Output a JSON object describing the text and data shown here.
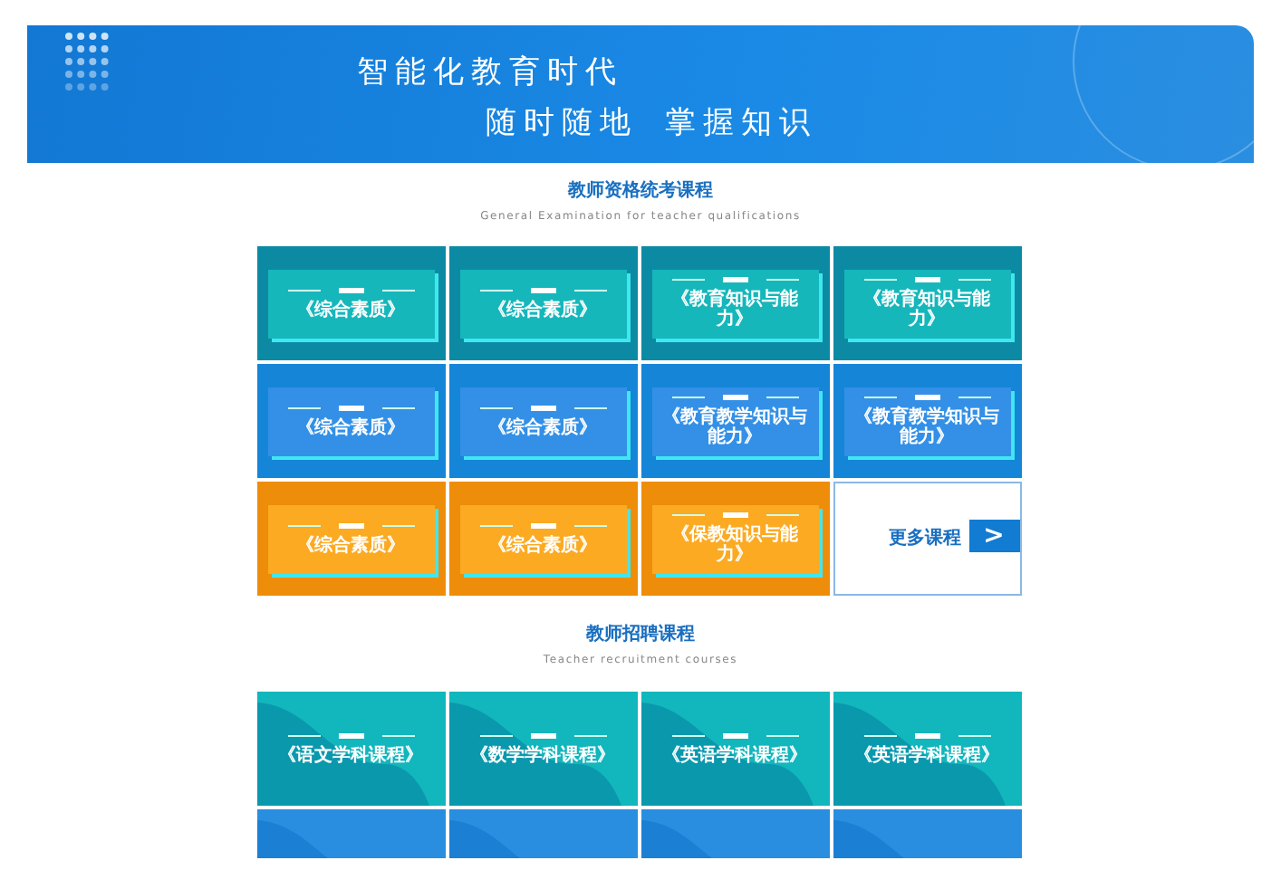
{
  "banner": {
    "line_1": "智能化教育时代",
    "line_2": "随时随地",
    "line_3": "掌握知识"
  },
  "sections": [
    {
      "title": "教师资格统考课程",
      "subtitle": "General Examination for teacher qualifications",
      "tiles": [
        {
          "kind": "teal",
          "title": "《综合素质》"
        },
        {
          "kind": "teal",
          "title": "《综合素质》"
        },
        {
          "kind": "teal",
          "title": "《教育知识与能力》"
        },
        {
          "kind": "teal",
          "title": "《教育知识与能力》"
        },
        {
          "kind": "blue",
          "title": "《综合素质》"
        },
        {
          "kind": "blue",
          "title": "《综合素质》"
        },
        {
          "kind": "blue",
          "title": "《教育教学知识与能力》"
        },
        {
          "kind": "blue",
          "title": "《教育教学知识与能力》"
        },
        {
          "kind": "orange",
          "title": "《综合素质》"
        },
        {
          "kind": "orange",
          "title": "《综合素质》"
        },
        {
          "kind": "orange",
          "title": "《保教知识与能力》"
        },
        {
          "kind": "more",
          "title": "更多课程",
          "arrow": ">"
        }
      ]
    },
    {
      "title": "教师招聘课程",
      "subtitle": "Teacher recruitment courses",
      "tiles": [
        {
          "kind": "wave-teal",
          "title": "《语文学科课程》"
        },
        {
          "kind": "wave-teal",
          "title": "《数学学科课程》"
        },
        {
          "kind": "wave-teal",
          "title": "《英语学科课程》"
        },
        {
          "kind": "wave-teal",
          "title": "《英语学科课程》"
        },
        {
          "kind": "wave-blue"
        },
        {
          "kind": "wave-blue"
        },
        {
          "kind": "wave-blue"
        },
        {
          "kind": "wave-blue"
        }
      ]
    }
  ]
}
